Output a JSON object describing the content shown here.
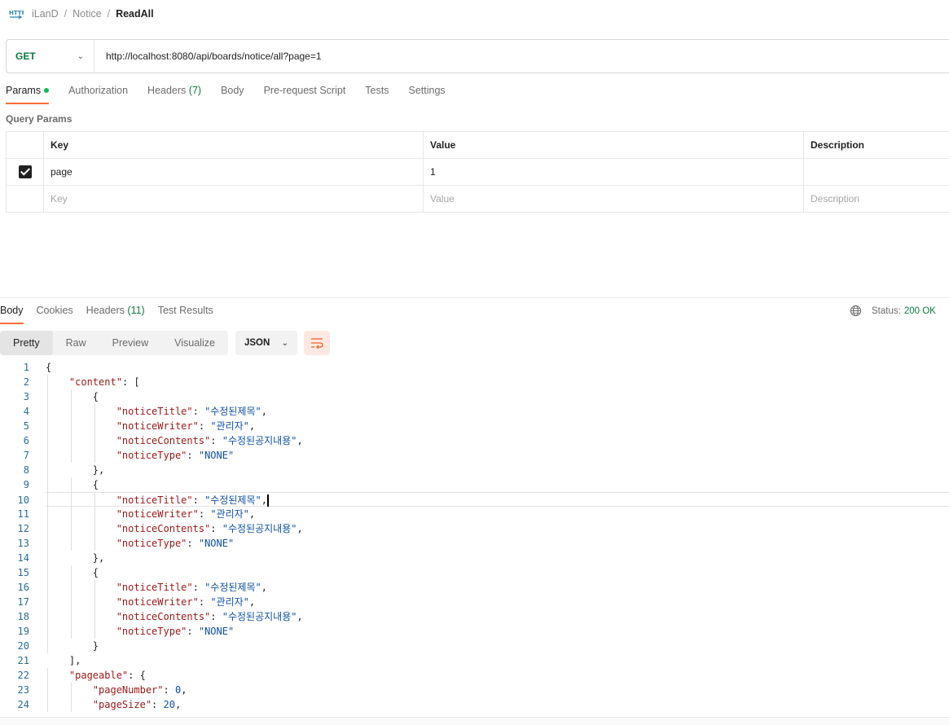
{
  "breadcrumb": {
    "items": [
      "iLanD",
      "Notice"
    ],
    "current": "ReadAll"
  },
  "request": {
    "method": "GET",
    "url": "http://localhost:8080/api/boards/notice/all?page=1",
    "method_color": "#0c7a43"
  },
  "request_tabs": [
    {
      "label": "Params",
      "active": true,
      "dot": true
    },
    {
      "label": "Authorization"
    },
    {
      "label": "Headers",
      "count": "(7)"
    },
    {
      "label": "Body"
    },
    {
      "label": "Pre-request Script"
    },
    {
      "label": "Tests"
    },
    {
      "label": "Settings"
    }
  ],
  "query_params": {
    "title": "Query Params",
    "headers": {
      "key": "Key",
      "value": "Value",
      "description": "Description"
    },
    "rows": [
      {
        "checked": true,
        "key": "page",
        "value": "1",
        "description": ""
      }
    ],
    "placeholders": {
      "key": "Key",
      "value": "Value",
      "description": "Description"
    }
  },
  "response_tabs": [
    {
      "label": "Body",
      "active": true
    },
    {
      "label": "Cookies"
    },
    {
      "label": "Headers",
      "count": "(11)"
    },
    {
      "label": "Test Results"
    }
  ],
  "status": {
    "label": "Status:",
    "value": "200 OK"
  },
  "view_modes": [
    "Pretty",
    "Raw",
    "Preview",
    "Visualize"
  ],
  "active_view": "Pretty",
  "format": "JSON",
  "accent_color": "#ff6c37",
  "code_lines": [
    "{",
    "    \"content\": [",
    "        {",
    "            \"noticeTitle\": \"수정된제목\",",
    "            \"noticeWriter\": \"관리자\",",
    "            \"noticeContents\": \"수정된공지내용\",",
    "            \"noticeType\": \"NONE\"",
    "        },",
    "        {",
    "            \"noticeTitle\": \"수정된제목\",",
    "            \"noticeWriter\": \"관리자\",",
    "            \"noticeContents\": \"수정된공지내용\",",
    "            \"noticeType\": \"NONE\"",
    "        },",
    "        {",
    "            \"noticeTitle\": \"수정된제목\",",
    "            \"noticeWriter\": \"관리자\",",
    "            \"noticeContents\": \"수정된공지내용\",",
    "            \"noticeType\": \"NONE\"",
    "        }",
    "    ],",
    "    \"pageable\": {",
    "        \"pageNumber\": 0,",
    "        \"pageSize\": 20,"
  ],
  "current_line": 10
}
